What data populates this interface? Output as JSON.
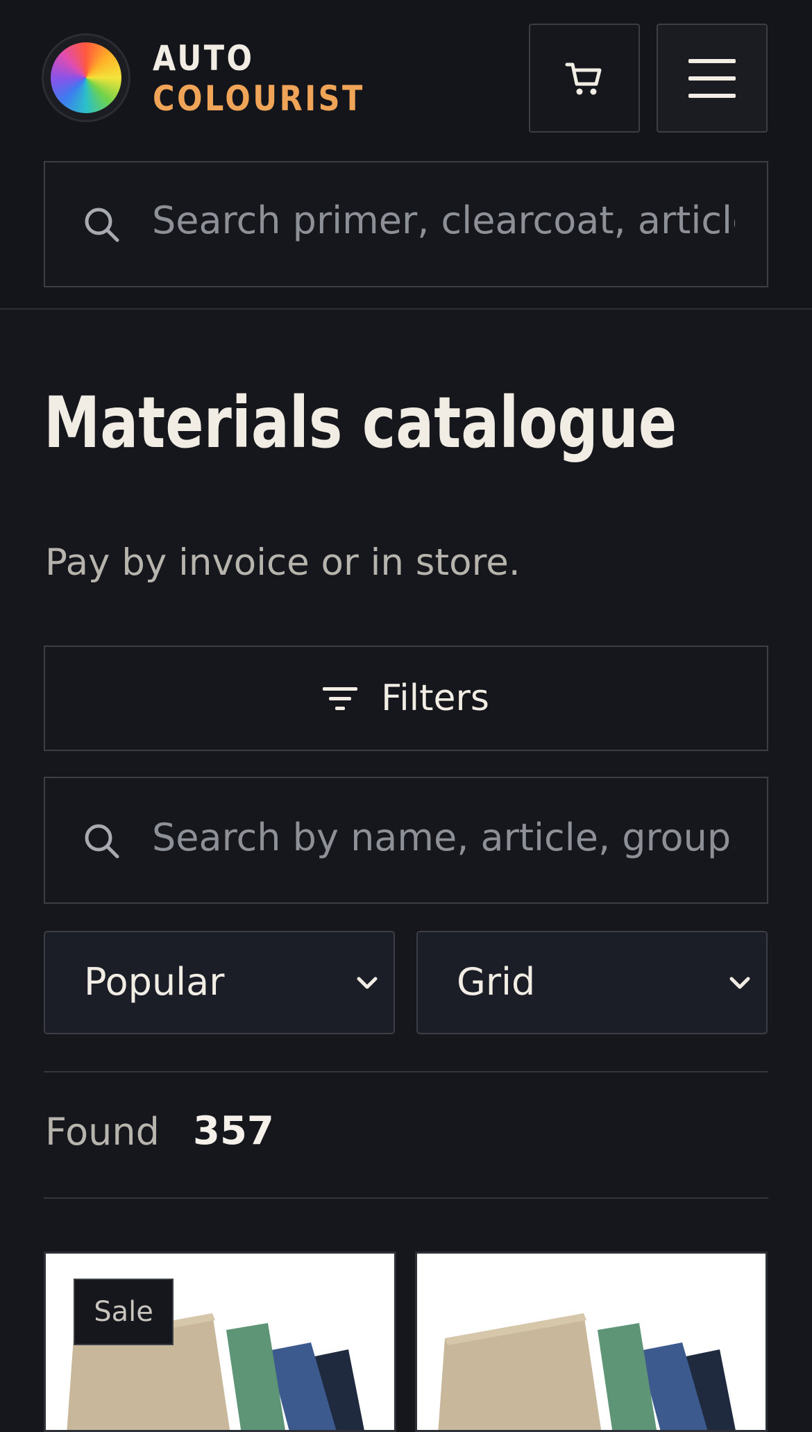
{
  "brand": {
    "name_top": "AUTO",
    "name_bottom": "COLOURIST",
    "accent_color": "#f0a458",
    "logo_icon": "color-wheel-icon"
  },
  "header": {
    "cart_icon": "cart-icon",
    "menu_icon": "hamburger-menu-icon",
    "search": {
      "placeholder": "Search primer, clearcoat, article"
    }
  },
  "main": {
    "title": "Materials catalogue",
    "subtitle": "Pay by invoice or in store.",
    "filters_label": "Filters",
    "search": {
      "placeholder": "Search by name, article, group.."
    },
    "sort": {
      "selected": "Popular"
    },
    "view": {
      "selected": "Grid"
    },
    "results": {
      "label": "Found",
      "count": "357"
    }
  },
  "products": [
    {
      "badge": "Sale"
    },
    {
      "badge": null
    }
  ]
}
